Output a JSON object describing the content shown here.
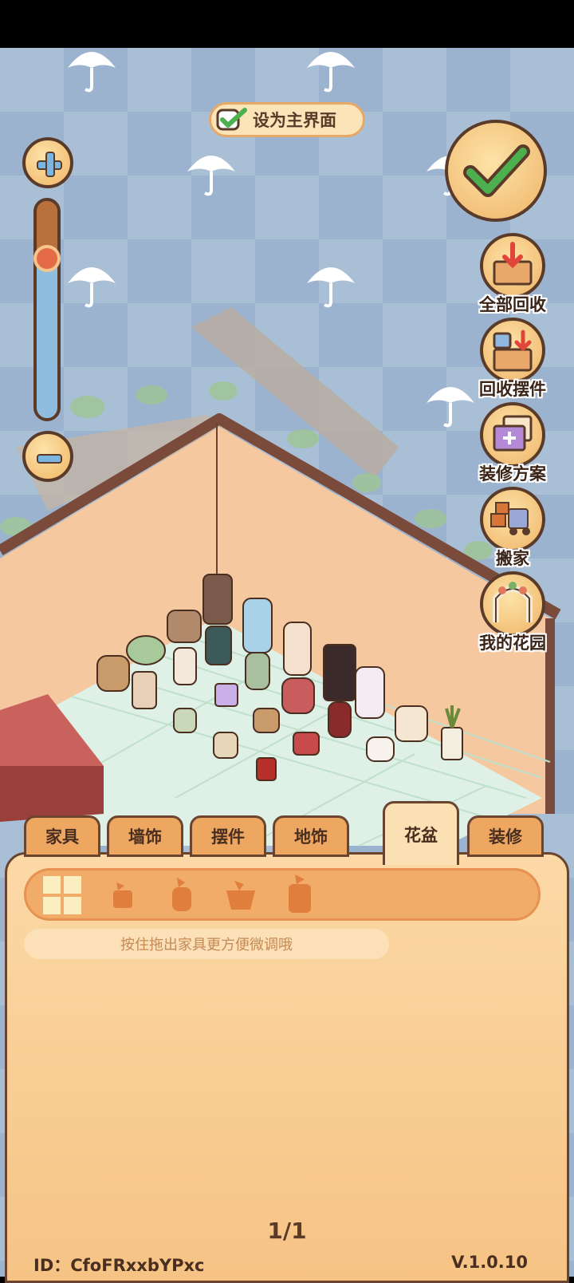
{
  "set_main": {
    "label": "设为主界面"
  },
  "side_buttons": [
    {
      "label": "全部回收"
    },
    {
      "label": "回收摆件"
    },
    {
      "label": "装修方案"
    },
    {
      "label": "搬家"
    },
    {
      "label": "我的花园"
    }
  ],
  "zoom": {
    "level": 0.27
  },
  "tabs": [
    {
      "label": "家具"
    },
    {
      "label": "墙饰"
    },
    {
      "label": "摆件"
    },
    {
      "label": "地饰"
    },
    {
      "label": "花盆"
    },
    {
      "label": "装修"
    }
  ],
  "active_tab": "花盆",
  "categories": [
    "all-grid-icon",
    "small-pot-icon",
    "tall-pot-icon",
    "wide-pot-icon",
    "jar-pot-icon"
  ],
  "hint": "按住拖出家具更方便微调哦",
  "pager": "1/1",
  "footer": {
    "id": "ID：CfoFRxxbYPxc",
    "version": "V.1.0.10"
  },
  "colors": {
    "accent": "#eea760",
    "outline": "#5a3b2a",
    "confirm_check": "#4bb04d"
  }
}
